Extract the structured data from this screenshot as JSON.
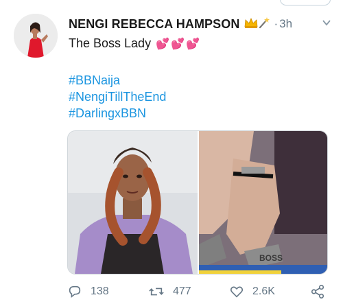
{
  "tweet": {
    "author_name": "NENGI REBECCA HAMPSON",
    "author_emojis": "👑🪄",
    "separator": "·",
    "timestamp": "3h",
    "text": "The Boss Lady",
    "text_emojis": "💕💕💕",
    "hashtags": [
      "#BBNaija",
      "#NengiTillTheEnd",
      "#DarlingxBBN"
    ],
    "media_caption_text": "BOSS"
  },
  "actions": {
    "reply_count": "138",
    "retweet_count": "477",
    "like_count": "2.6K"
  },
  "colors": {
    "link": "#1b95e0",
    "muted": "#657786",
    "heart_emoji": "#d8235f"
  },
  "icons": [
    "avatar-photo",
    "crown-emoji",
    "wand-emoji",
    "caret-down-icon",
    "reply-icon",
    "retweet-icon",
    "like-icon",
    "share-icon"
  ]
}
